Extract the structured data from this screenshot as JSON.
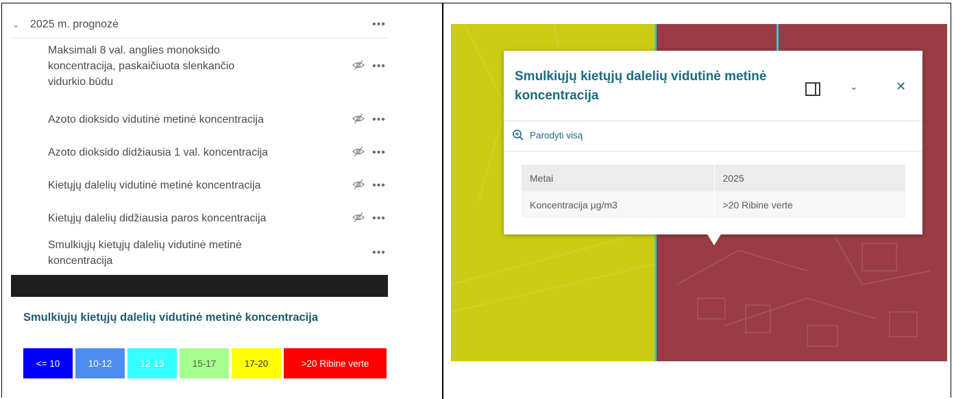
{
  "layers_panel": {
    "group": {
      "title": "2025 m. prognozė",
      "chevron": "chevron-down-icon",
      "options": "more-options-icon"
    },
    "layers": [
      {
        "lines": [
          "Maksimali 8 val. anglies monoksido",
          "koncentracija, paskaičiuota slenkančio",
          "vidurkio būdu"
        ],
        "visibility": "hidden"
      },
      {
        "lines": [
          "Azoto dioksido vidutinė metinė koncentracija"
        ],
        "visibility": "hidden"
      },
      {
        "lines": [
          "Azoto dioksido didžiausia 1 val. koncentracija"
        ],
        "visibility": "hidden"
      },
      {
        "lines": [
          "Kietųjų dalelių vidutinė metinė koncentracija"
        ],
        "visibility": "hidden"
      },
      {
        "lines": [
          "Kietųjų dalelių didžiausia paros koncentracija"
        ],
        "visibility": "hidden"
      },
      {
        "lines": [
          "Smulkiųjų kietųjų dalelių vidutinė metinė",
          "koncentracija"
        ],
        "visibility": "visible"
      }
    ]
  },
  "legend": {
    "title": "Smulkiųjų kietųjų dalelių vidutinė metinė koncentracija",
    "classes": [
      {
        "label": "<= 10",
        "color": "#0000ff",
        "text_color": "#ffffff"
      },
      {
        "label": "10-12",
        "color": "#4d8ef0",
        "text_color": "#ffffff"
      },
      {
        "label": "12-15",
        "color": "#33ffff",
        "text_color": "#ffffff"
      },
      {
        "label": "15-17",
        "color": "#a6ff8c",
        "text_color": "#555555"
      },
      {
        "label": "17-20",
        "color": "#ffff00",
        "text_color": "#333333"
      },
      {
        "label": ">20 Ribine verte",
        "color": "#ff0000",
        "text_color": "#ffffff"
      }
    ]
  },
  "map": {
    "zone_colors": {
      "lower": "#cccc14",
      "upper": "#9a3c44",
      "boundary": "#33cccc"
    }
  },
  "popup": {
    "title": "Smulkiųjų kietųjų dalelių vidutinė metinė koncentracija",
    "icons": {
      "dock": "dock-icon",
      "collapse": "chevron-down-icon",
      "close": "close-icon",
      "zoom": "zoom-in-icon"
    },
    "zoom_to_label": "Parodyti visą",
    "fields": [
      {
        "key": "Metai",
        "value": "2025"
      },
      {
        "key": "Koncentracija µg/m3",
        "value": ">20 Ribine verte"
      }
    ]
  }
}
